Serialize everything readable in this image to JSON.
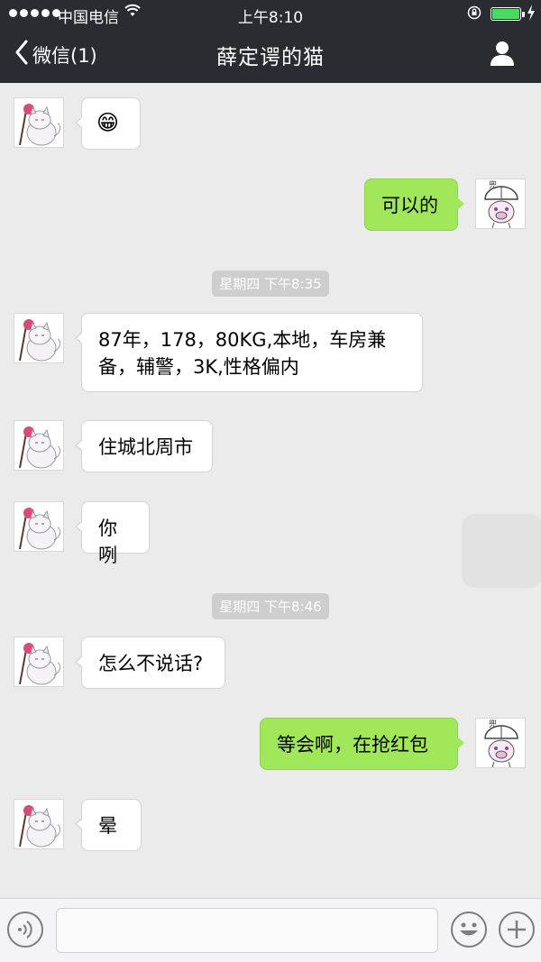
{
  "status_bar": {
    "carrier": "中国电信",
    "time": "上午8:10"
  },
  "nav": {
    "back_label": "微信(1)",
    "title": "薛定谔的猫"
  },
  "messages": [
    {
      "side": "in",
      "text": "😁"
    },
    {
      "side": "out",
      "text": "可以的"
    },
    {
      "side": "time",
      "text": "星期四 下午8:35"
    },
    {
      "side": "in",
      "text": "87年，178，80KG,本地，车房兼备，辅警，3K,性格偏内"
    },
    {
      "side": "in",
      "text": "住城北周市"
    },
    {
      "side": "in",
      "text": "你咧"
    },
    {
      "side": "time",
      "text": "星期四 下午8:46"
    },
    {
      "side": "in",
      "text": "怎么不说话?"
    },
    {
      "side": "out",
      "text": "等会啊，在抢红包"
    },
    {
      "side": "in",
      "text": "晕"
    }
  ],
  "input": {
    "value": "",
    "placeholder": ""
  },
  "colors": {
    "nav_bg": "#2b2c31",
    "chat_bg": "#ebebeb",
    "outgoing_bubble": "#a0e75a",
    "incoming_bubble": "#ffffff",
    "battery": "#4cd964"
  },
  "icons": {
    "back": "chevron-left-icon",
    "profile": "person-icon",
    "voice": "voice-icon",
    "emoji": "emoji-icon",
    "plus": "plus-icon"
  }
}
